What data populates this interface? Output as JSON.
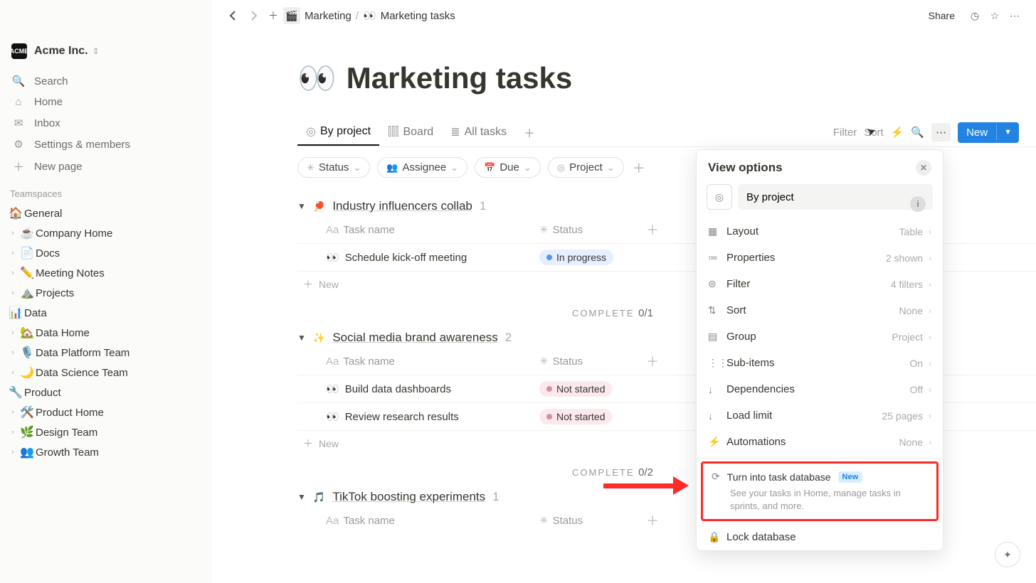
{
  "workspace": {
    "abbrev": "ACME",
    "name": "Acme Inc."
  },
  "nav": [
    {
      "icon": "🔍",
      "label": "Search"
    },
    {
      "icon": "⌂",
      "label": "Home"
    },
    {
      "icon": "✉",
      "label": "Inbox"
    },
    {
      "icon": "⚙",
      "label": "Settings & members"
    },
    {
      "icon": "＋",
      "label": "New page"
    }
  ],
  "teamspaces_label": "Teamspaces",
  "sections": [
    {
      "emoji": "🏠",
      "title": "General",
      "children": [
        {
          "emoji": "☕",
          "label": "Company Home"
        },
        {
          "emoji": "📄",
          "label": "Docs"
        },
        {
          "emoji": "✏️",
          "label": "Meeting Notes"
        },
        {
          "emoji": "⛰️",
          "label": "Projects"
        }
      ]
    },
    {
      "emoji": "📊",
      "title": "Data",
      "children": [
        {
          "emoji": "🏡",
          "label": "Data Home"
        },
        {
          "emoji": "🎙️",
          "label": "Data Platform Team"
        },
        {
          "emoji": "🌙",
          "label": "Data Science Team"
        }
      ]
    },
    {
      "emoji": "🔧",
      "title": "Product",
      "children": [
        {
          "emoji": "🛠️",
          "label": "Product Home"
        },
        {
          "emoji": "🌿",
          "label": "Design Team"
        },
        {
          "emoji": "👥",
          "label": "Growth Team"
        }
      ]
    }
  ],
  "breadcrumb": {
    "parent": "Marketing",
    "current": "Marketing tasks"
  },
  "topbar": {
    "share": "Share"
  },
  "page": {
    "emoji": "👀",
    "title": "Marketing tasks"
  },
  "tabs": [
    {
      "icon": "◎",
      "label": "By project",
      "active": true
    },
    {
      "icon": "⫿⫿⫿",
      "label": "Board"
    },
    {
      "icon": "≣",
      "label": "All tasks"
    }
  ],
  "actions": {
    "filter": "Filter",
    "sort": "Sort",
    "new": "New"
  },
  "filters": [
    {
      "icon": "✳",
      "label": "Status"
    },
    {
      "icon": "👥",
      "label": "Assignee"
    },
    {
      "icon": "📅",
      "label": "Due"
    },
    {
      "icon": "◎",
      "label": "Project"
    }
  ],
  "columns": {
    "name": "Task name",
    "status": "Status",
    "new": "New"
  },
  "groups": [
    {
      "emoji": "🏓",
      "title": "Industry influencers collab",
      "count": "1",
      "rows": [
        {
          "emoji": "👀",
          "name": "Schedule kick-off meeting",
          "status": "In progress",
          "status_class": "progress"
        }
      ],
      "complete": "0/1"
    },
    {
      "emoji": "✨",
      "title": "Social media brand awareness",
      "count": "2",
      "rows": [
        {
          "emoji": "👀",
          "name": "Build data dashboards",
          "status": "Not started",
          "status_class": "notstarted"
        },
        {
          "emoji": "👀",
          "name": "Review research results",
          "status": "Not started",
          "status_class": "notstarted"
        }
      ],
      "complete": "0/2"
    },
    {
      "emoji": "🎵",
      "title": "TikTok boosting experiments",
      "count": "1",
      "rows": []
    }
  ],
  "complete_label": "COMPLETE",
  "vopts": {
    "title": "View options",
    "name": "By project",
    "rows": [
      {
        "icon": "▦",
        "label": "Layout",
        "value": "Table"
      },
      {
        "icon": "≔",
        "label": "Properties",
        "value": "2 shown"
      },
      {
        "icon": "⊜",
        "label": "Filter",
        "value": "4 filters"
      },
      {
        "icon": "⇅",
        "label": "Sort",
        "value": "None"
      },
      {
        "icon": "▤",
        "label": "Group",
        "value": "Project"
      },
      {
        "icon": "⋮⋮",
        "label": "Sub-items",
        "value": "On"
      },
      {
        "icon": "↓",
        "label": "Dependencies",
        "value": "Off"
      },
      {
        "icon": "↓",
        "label": "Load limit",
        "value": "25 pages"
      },
      {
        "icon": "⚡",
        "label": "Automations",
        "value": "None"
      }
    ],
    "turn": {
      "label": "Turn into task database",
      "badge": "New",
      "desc": "See your tasks in Home, manage tasks in sprints, and more."
    },
    "lock": {
      "label": "Lock database"
    }
  }
}
